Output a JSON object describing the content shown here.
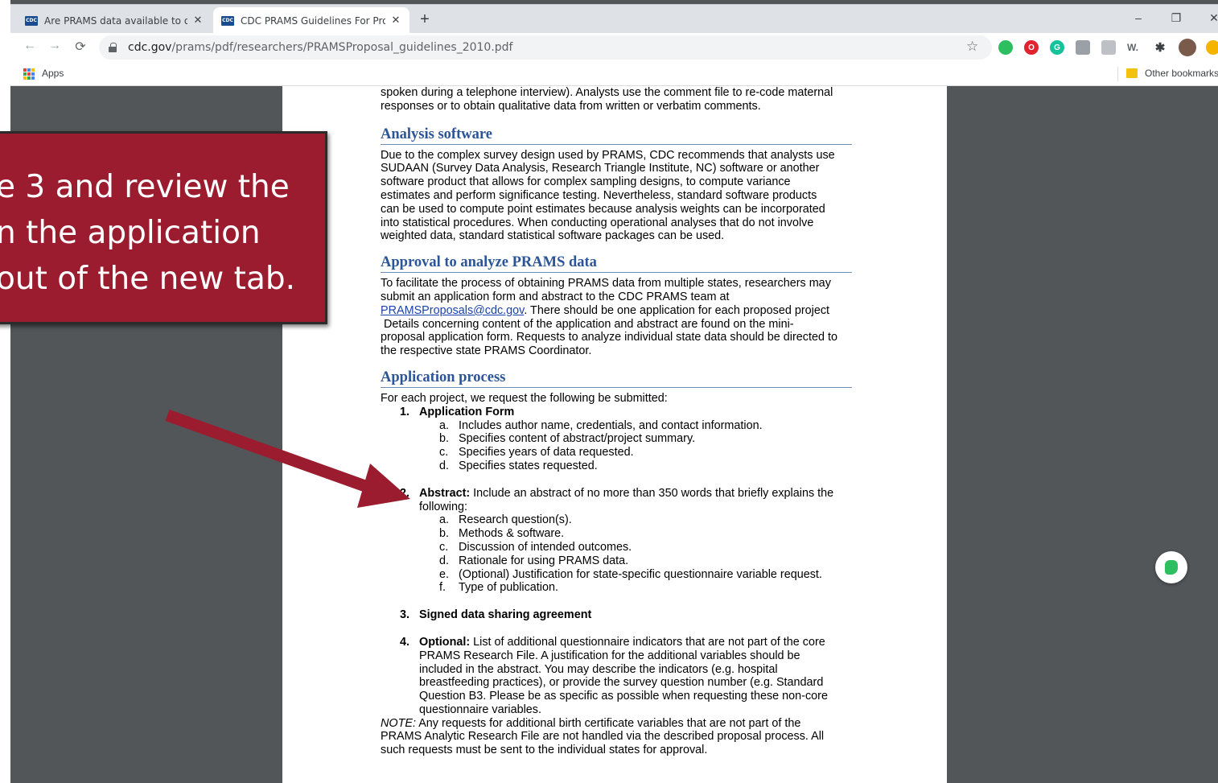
{
  "tabs": [
    {
      "title": "Are PRAMS data available to out",
      "favicon_text": "CDC"
    },
    {
      "title": "CDC PRAMS Guidelines For Prop",
      "favicon_text": "CDC"
    }
  ],
  "window_controls": {
    "minimize": "–",
    "restore": "❐",
    "close": "✕"
  },
  "toolbar": {
    "url_host": "cdc.gov",
    "url_path": "/prams/pdf/researchers/PRAMSProposal_guidelines_2010.pdf"
  },
  "bookmarks": {
    "apps_label": "Apps",
    "other_label": "Other bookmarks"
  },
  "extensions": [
    {
      "name": "evernote-ext-icon",
      "color": "#2dbe60"
    },
    {
      "name": "opera-ext-icon",
      "color": "#e0232e",
      "glyph": "O"
    },
    {
      "name": "grammarly-ext-icon",
      "color": "#15c39a",
      "glyph": "G"
    },
    {
      "name": "reader-ext-icon",
      "color": "#9aa0a6"
    },
    {
      "name": "generic-ext-icon",
      "color": "#bdc1c6"
    },
    {
      "name": "wordtune-ext-icon",
      "color": "#5f6368",
      "glyph": "W."
    },
    {
      "name": "puzzle-ext-icon",
      "color": "#3c4043"
    },
    {
      "name": "profile-avatar",
      "color": "#7a5a4a"
    },
    {
      "name": "update-icon",
      "color": "#f4b400"
    }
  ],
  "pdf": {
    "intro_lines": [
      "spoken during a telephone interview). Analysts use the comment file to re-code maternal",
      "responses or to obtain qualitative data from written or verbatim comments."
    ],
    "sections": {
      "analysis_software": {
        "heading": "Analysis software",
        "lines": [
          "Due to the complex survey design used by PRAMS, CDC recommends that analysts use",
          "SUDAAN (Survey Data Analysis, Research Triangle Institute, NC) software or another",
          "software product that allows for complex sampling designs, to compute variance",
          "estimates and perform significance testing. Nevertheless, standard software products",
          "can be used to compute point estimates because analysis weights can be incorporated",
          "into statistical procedures. When conducting operational analyses that do not involve",
          "weighted data, standard statistical software packages can be used."
        ]
      },
      "approval": {
        "heading": "Approval to analyze PRAMS data",
        "line1": "To facilitate the process of obtaining PRAMS data from multiple states, researchers may",
        "line2": "submit an application form and abstract to the CDC PRAMS team at",
        "email": "PRAMSProposals@cdc.gov",
        "line3_rest": ". There should be one application for each proposed project",
        "line4": " Details concerning content of the application and abstract are found on the mini-",
        "line5": "proposal application form. Requests to analyze individual state data should be directed to",
        "line6": "the respective state PRAMS Coordinator."
      },
      "application_process": {
        "heading": "Application process",
        "intro": "For each project, we request the following be submitted:",
        "item1": {
          "num": "1.",
          "label": "Application Form",
          "subs": [
            {
              "letter": "a.",
              "text": "Includes author name, credentials, and contact information."
            },
            {
              "letter": "b.",
              "text": "Specifies content of abstract/project summary."
            },
            {
              "letter": "c.",
              "text": "Specifies years of data requested."
            },
            {
              "letter": "d.",
              "text": "Specifies states requested."
            }
          ]
        },
        "item2": {
          "num": "2.",
          "label": "Abstract:",
          "text_line1": " Include an abstract of no more than 350 words that briefly explains the",
          "text_line2": "following:",
          "subs": [
            {
              "letter": "a.",
              "text": "Research question(s)."
            },
            {
              "letter": "b.",
              "text": "Methods & software."
            },
            {
              "letter": "c.",
              "text": "Discussion of intended outcomes."
            },
            {
              "letter": "d.",
              "text": "Rationale for using PRAMS data."
            },
            {
              "letter": "e.",
              "text": "(Optional) Justification for state-specific questionnaire variable request."
            },
            {
              "letter": "f.",
              "text": "Type of publication."
            }
          ]
        },
        "item3": {
          "num": "3.",
          "label": "Signed data sharing agreement"
        },
        "item4": {
          "num": "4.",
          "label": "Optional:",
          "lines": [
            " List of additional questionnaire indicators that are not part of the core",
            "PRAMS Research File. A justification for the additional variables should be",
            "included in the abstract. You may describe the indicators (e.g. hospital",
            "breastfeeding practices), or provide the survey question number (e.g. Standard",
            "Question B3. Please be as specific as possible when requesting these non-core",
            "questionnaire variables."
          ]
        },
        "note": {
          "label": "NOTE:",
          "line1": " Any requests for additional birth certificate variables that are not part of the",
          "line2": "PRAMS Analytic Research File are not handled via the described proposal process. All",
          "line3": "such requests must be sent to the individual states for approval."
        }
      }
    }
  },
  "callout": {
    "lines": [
      "e 3 and review the",
      "n the application",
      "out of the new tab."
    ],
    "color": "#9b1c2e"
  },
  "arrow_color": "#9b1c2e"
}
